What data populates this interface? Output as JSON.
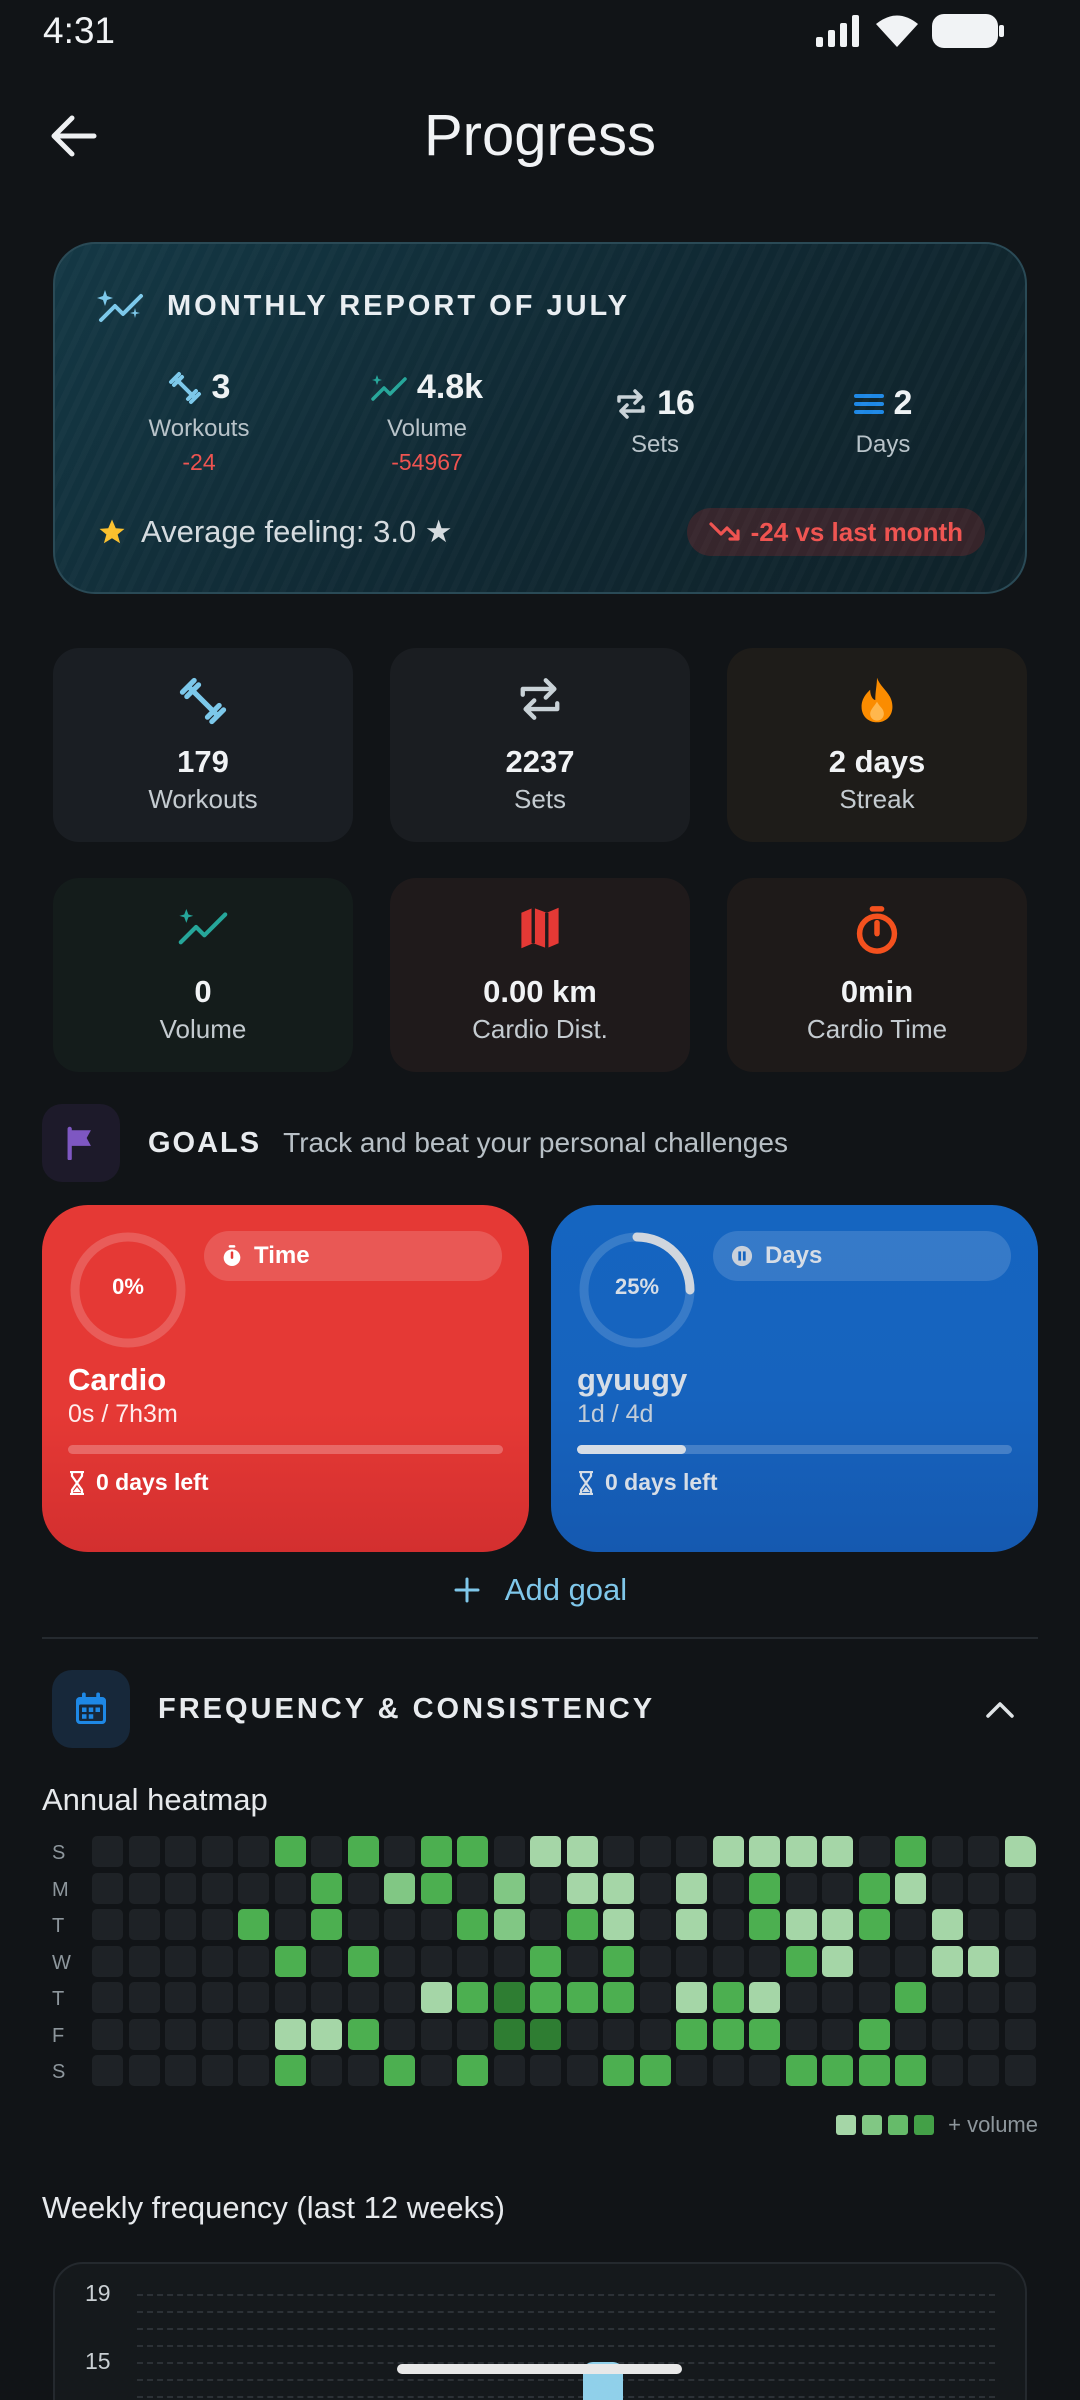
{
  "status_bar": {
    "time": "4:31"
  },
  "app_bar": {
    "title": "Progress"
  },
  "monthly_report": {
    "title": "MONTHLY REPORT OF JULY",
    "stats": [
      {
        "icon": "dumbbell-icon",
        "value": "3",
        "label": "Workouts",
        "delta": "-24"
      },
      {
        "icon": "trend-icon",
        "value": "4.8k",
        "label": "Volume",
        "delta": "-54967"
      },
      {
        "icon": "repeat-icon",
        "value": "16",
        "label": "Sets",
        "delta": ""
      },
      {
        "icon": "bars-icon",
        "value": "2",
        "label": "Days",
        "delta": ""
      }
    ],
    "feeling": "Average feeling: 3.0 ★",
    "comparison": "-24 vs last month"
  },
  "summary_tiles": [
    {
      "icon": "dumbbell-icon",
      "value": "179",
      "label": "Workouts"
    },
    {
      "icon": "repeat-icon",
      "value": "2237",
      "label": "Sets"
    },
    {
      "icon": "flame-icon",
      "value": "2 days",
      "label": "Streak"
    },
    {
      "icon": "trend-icon",
      "value": "0",
      "label": "Volume"
    },
    {
      "icon": "map-icon",
      "value": "0.00 km",
      "label": "Cardio Dist."
    },
    {
      "icon": "timer-icon",
      "value": "0min",
      "label": "Cardio Time"
    }
  ],
  "goals": {
    "label": "GOALS",
    "subtitle": "Track and beat your personal challenges",
    "cards": [
      {
        "percent_label": "0%",
        "progress": 0,
        "type": "Time",
        "name": "Cardio",
        "progress_text": "0s / 7h3m",
        "days_left": "0 days left",
        "color": "#e53935"
      },
      {
        "percent_label": "25%",
        "progress": 0.25,
        "type": "Days",
        "name": "gyuugy",
        "progress_text": "1d / 4d",
        "days_left": "0 days left",
        "color": "#1565c0"
      }
    ],
    "add_label": "Add goal"
  },
  "frequency": {
    "title": "FREQUENCY & CONSISTENCY",
    "heatmap_title": "Annual heatmap",
    "day_labels": [
      "S",
      "M",
      "T",
      "W",
      "T",
      "F",
      "S"
    ],
    "legend_label": "+ volume",
    "colors": [
      "#1e2226",
      "#a5d6a7",
      "#81c784",
      "#4caf50",
      "#2e7d32"
    ],
    "heatmap": [
      [
        0,
        0,
        0,
        0,
        0,
        3,
        0,
        3,
        0,
        3,
        3,
        0,
        1,
        1,
        0,
        0,
        0,
        1,
        1,
        1,
        1,
        0,
        3,
        0,
        0,
        1
      ],
      [
        0,
        0,
        0,
        0,
        0,
        0,
        3,
        0,
        2,
        3,
        0,
        2,
        0,
        1,
        1,
        0,
        1,
        0,
        3,
        0,
        0,
        3,
        1,
        0,
        0,
        0
      ],
      [
        0,
        0,
        0,
        0,
        3,
        0,
        3,
        0,
        0,
        0,
        3,
        2,
        0,
        3,
        1,
        0,
        1,
        0,
        3,
        1,
        1,
        3,
        0,
        1,
        0,
        0,
        3
      ],
      [
        0,
        0,
        0,
        0,
        0,
        3,
        0,
        3,
        0,
        0,
        0,
        0,
        3,
        0,
        3,
        0,
        0,
        0,
        0,
        3,
        1,
        0,
        0,
        1,
        1,
        0
      ],
      [
        0,
        0,
        0,
        0,
        0,
        0,
        0,
        0,
        0,
        1,
        3,
        4,
        3,
        3,
        3,
        0,
        1,
        3,
        1,
        0,
        0,
        0,
        3,
        0,
        0,
        0
      ],
      [
        0,
        0,
        0,
        0,
        0,
        1,
        1,
        3,
        0,
        0,
        0,
        4,
        4,
        0,
        0,
        0,
        3,
        3,
        3,
        0,
        0,
        3,
        0,
        0,
        0,
        0
      ],
      [
        0,
        0,
        0,
        0,
        0,
        3,
        0,
        0,
        3,
        0,
        3,
        0,
        0,
        0,
        3,
        3,
        0,
        0,
        0,
        3,
        3,
        3,
        3,
        0,
        0,
        0
      ]
    ],
    "weekly_title": "Weekly frequency (last 12 weeks)"
  },
  "chart_data": {
    "type": "bar",
    "title": "Weekly frequency (last 12 weeks)",
    "y_ticks": [
      19,
      15
    ],
    "visible_values": [
      15
    ]
  }
}
